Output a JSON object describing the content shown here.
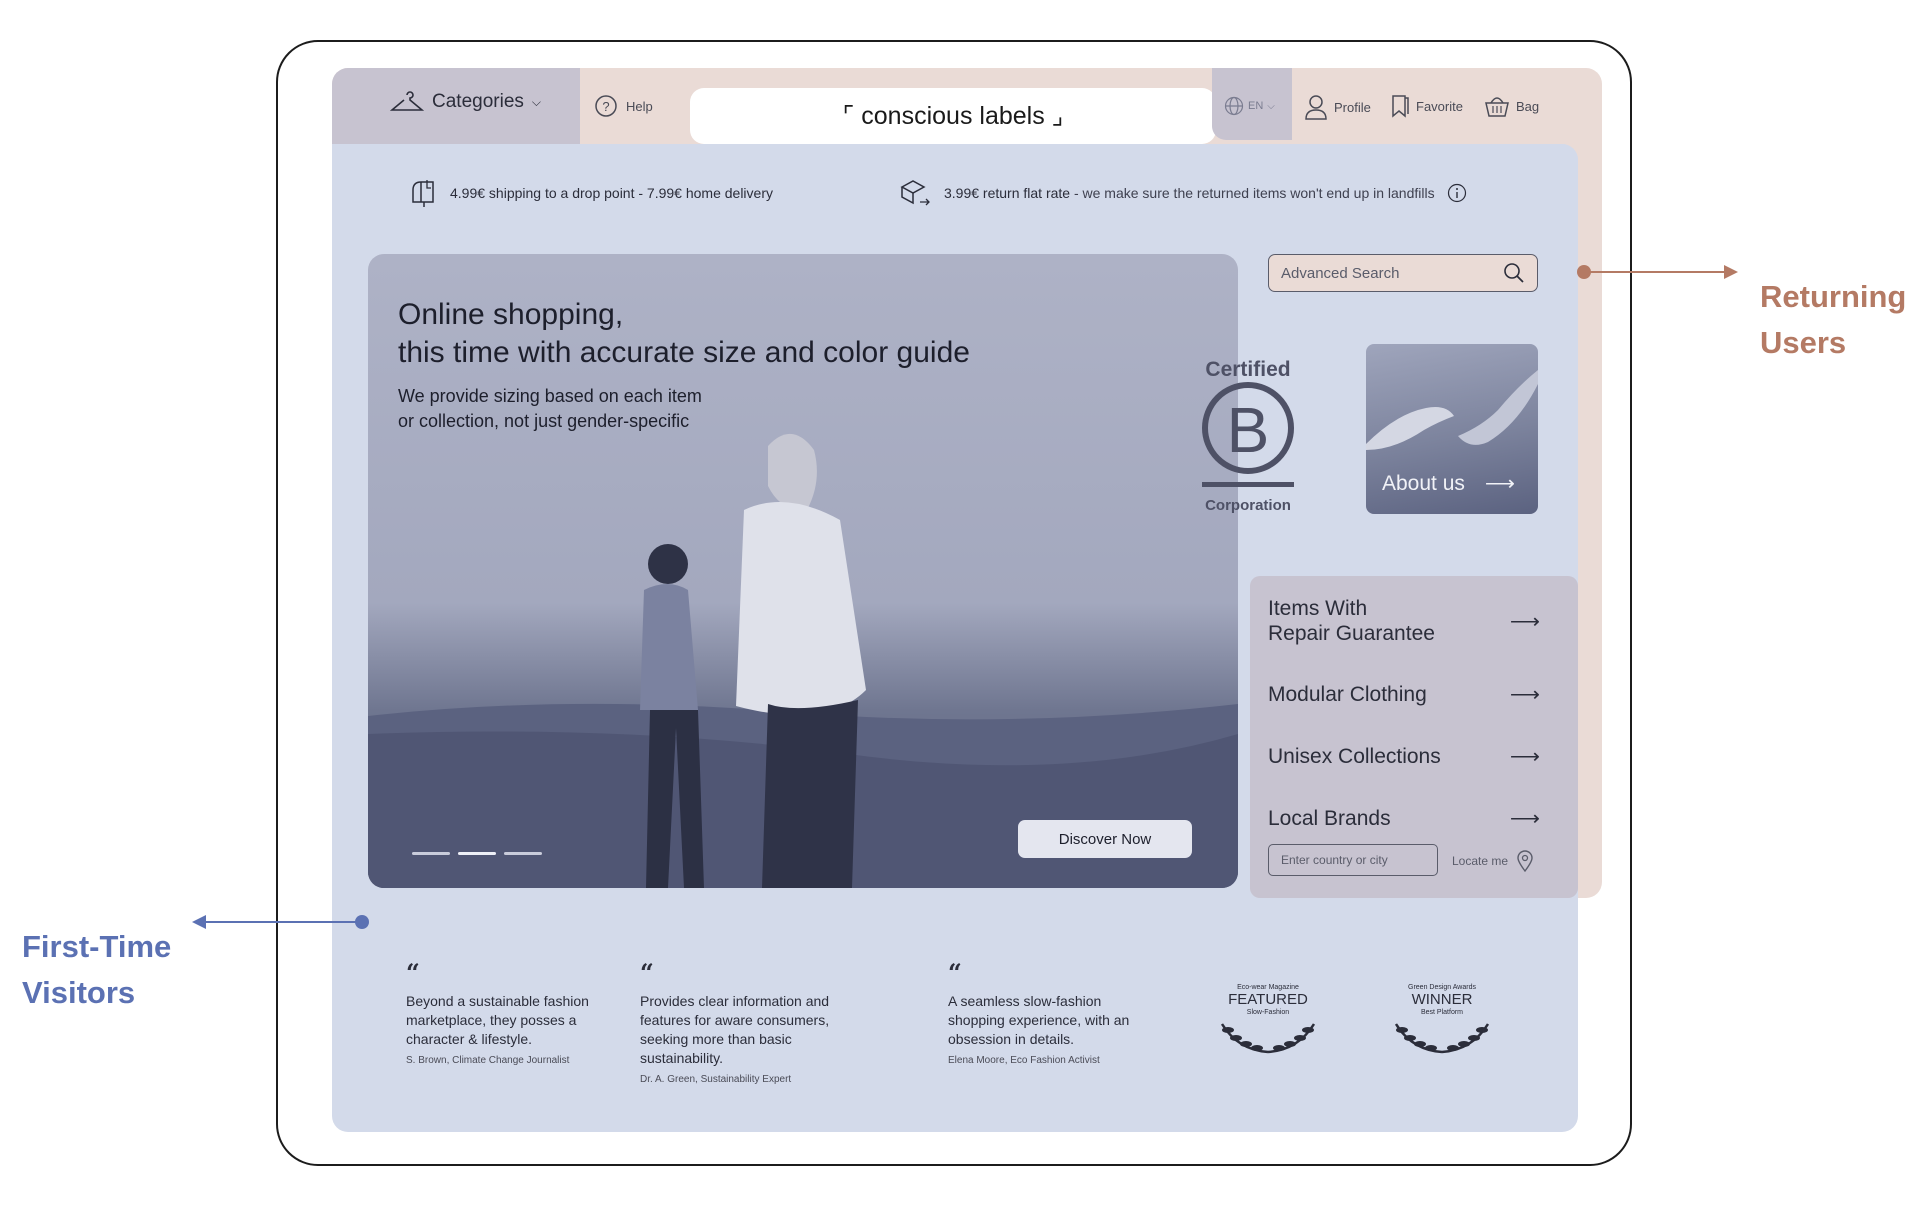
{
  "header": {
    "categories_label": "Categories",
    "help_label": "Help",
    "brand": "⌜ conscious labels ⌟",
    "language": "EN",
    "profile_label": "Profile",
    "favorite_label": "Favorite",
    "bag_label": "Bag"
  },
  "shipping": {
    "delivery": "4.99€ shipping to a drop point - 7.99€ home delivery",
    "returns_strong": "3.99€ return flat rate",
    "returns_rest": " - we make sure the returned items won't end up in landfills"
  },
  "hero": {
    "title_line1": "Online shopping,",
    "title_line2": "this time with accurate size and color guide",
    "sub_line1": "We provide sizing based on each item",
    "sub_line2": "or collection, not just gender-specific",
    "cta": "Discover Now",
    "slides_total": 3,
    "active_slide": 2
  },
  "search": {
    "placeholder": "Advanced Search"
  },
  "certification": {
    "top": "Certified",
    "bottom": "Corporation"
  },
  "about": {
    "label": "About us"
  },
  "categories": [
    {
      "label_line1": "Items With",
      "label_line2": "Repair Guarantee"
    },
    {
      "label_line1": "Modular Clothing",
      "label_line2": ""
    },
    {
      "label_line1": "Unisex Collections",
      "label_line2": ""
    },
    {
      "label_line1": "Local Brands",
      "label_line2": ""
    }
  ],
  "location": {
    "placeholder": "Enter country or city",
    "locate_label": "Locate me"
  },
  "testimonials": [
    {
      "text": "Beyond a sustainable fashion marketplace, they posses a character & lifestyle.",
      "author": "S. Brown, Climate Change Journalist"
    },
    {
      "text": "Provides clear information and  features for aware consumers, seeking more than basic sustainability.",
      "author": "Dr. A. Green, Sustainability Expert"
    },
    {
      "text": "A seamless slow-fashion shopping experience, with an obsession in details.",
      "author": "Elena Moore, Eco Fashion Activist"
    }
  ],
  "awards": [
    {
      "source": "Eco-wear Magazine",
      "title": "FEATURED",
      "subtitle": "Slow-Fashion"
    },
    {
      "source": "Green Design Awards",
      "title": "WINNER",
      "subtitle": "Best Platform"
    }
  ],
  "annotations": {
    "returning_line1": "Returning",
    "returning_line2": "Users",
    "first_line1": "First-Time",
    "first_line2": "Visitors"
  },
  "colors": {
    "returning_accent": "#b47a64",
    "first_time_accent": "#5b71b3",
    "pink_zone": "#eadbd6",
    "blue_zone": "#d3daea",
    "mauve_zone": "#c7c3d0"
  }
}
